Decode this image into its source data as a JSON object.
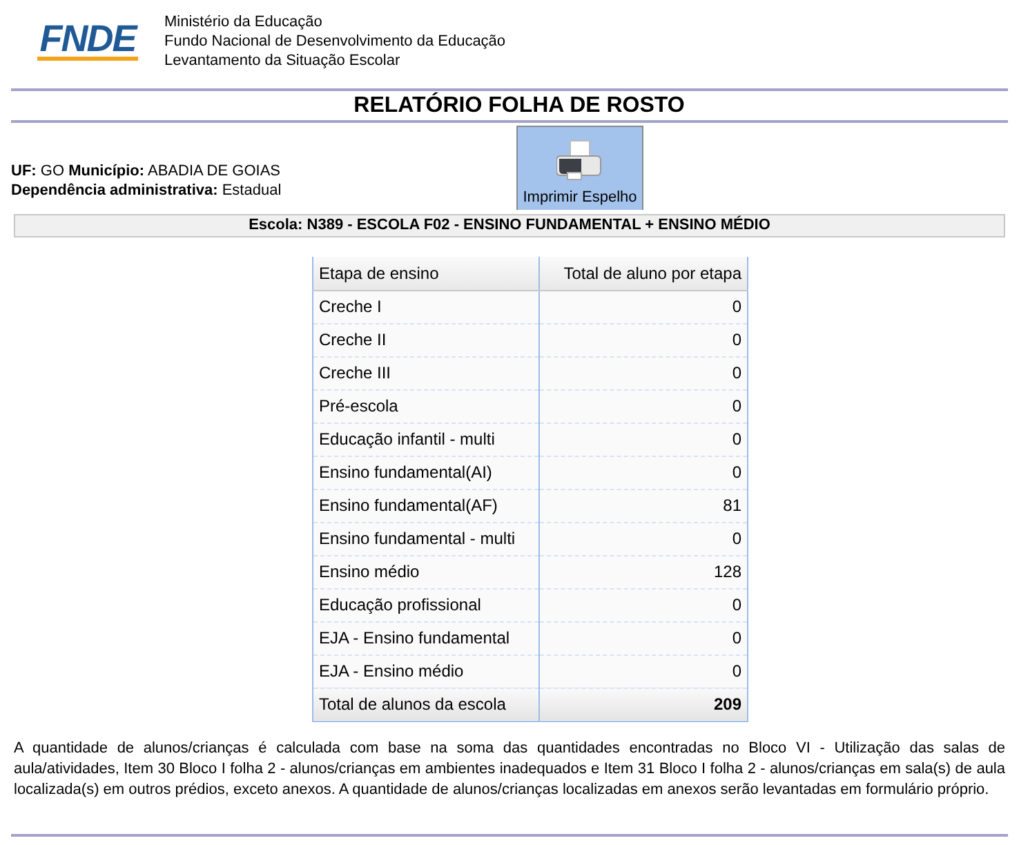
{
  "header": {
    "logo": "FNDE",
    "lines": [
      "Ministério da Educação",
      "Fundo Nacional de Desenvolvimento da Educação",
      "Levantamento da Situação Escolar"
    ]
  },
  "title": "RELATÓRIO FOLHA DE ROSTO",
  "info": [
    "**UF:** GO **Município:** ABADIA DE GOIAS",
    "**Dependência administrativa:** Estadual"
  ],
  "print_button": {
    "label": "Imprimir Espelho"
  },
  "school": "Escola: N389 - ESCOLA F02 - ENSINO FUNDAMENTAL + ENSINO MÉDIO",
  "table": {
    "columns": [
      "Etapa de ensino",
      "Total de aluno por etapa"
    ],
    "rows": [
      {
        "stage": "Creche I",
        "total": "0"
      },
      {
        "stage": "Creche II",
        "total": "0"
      },
      {
        "stage": "Creche III",
        "total": "0"
      },
      {
        "stage": "Pré-escola",
        "total": "0"
      },
      {
        "stage": "Educação infantil - multi",
        "total": "0"
      },
      {
        "stage": "Ensino fundamental(AI)",
        "total": "0"
      },
      {
        "stage": "Ensino fundamental(AF)",
        "total": "81"
      },
      {
        "stage": "Ensino fundamental - multi",
        "total": "0"
      },
      {
        "stage": "Ensino médio",
        "total": "128"
      },
      {
        "stage": "Educação profissional",
        "total": "0"
      },
      {
        "stage": "EJA - Ensino fundamental",
        "total": "0"
      },
      {
        "stage": "EJA - Ensino médio",
        "total": "0"
      }
    ],
    "total_row": {
      "stage": "Total de alunos da escola",
      "total": "209"
    }
  },
  "footnote": "A quantidade de alunos/crianças é calculada com base na soma das quantidades encontradas no Bloco VI - Utilização das salas de aula/atividades, Item 30 Bloco I folha 2 - alunos/crianças em ambientes inadequados e Item 31 Bloco I folha 2 - alunos/crianças em sala(s) de aula localizada(s) em outros prédios, exceto anexos. A quantidade de alunos/crianças localizadas em anexos serão levantadas em formulário próprio."
}
